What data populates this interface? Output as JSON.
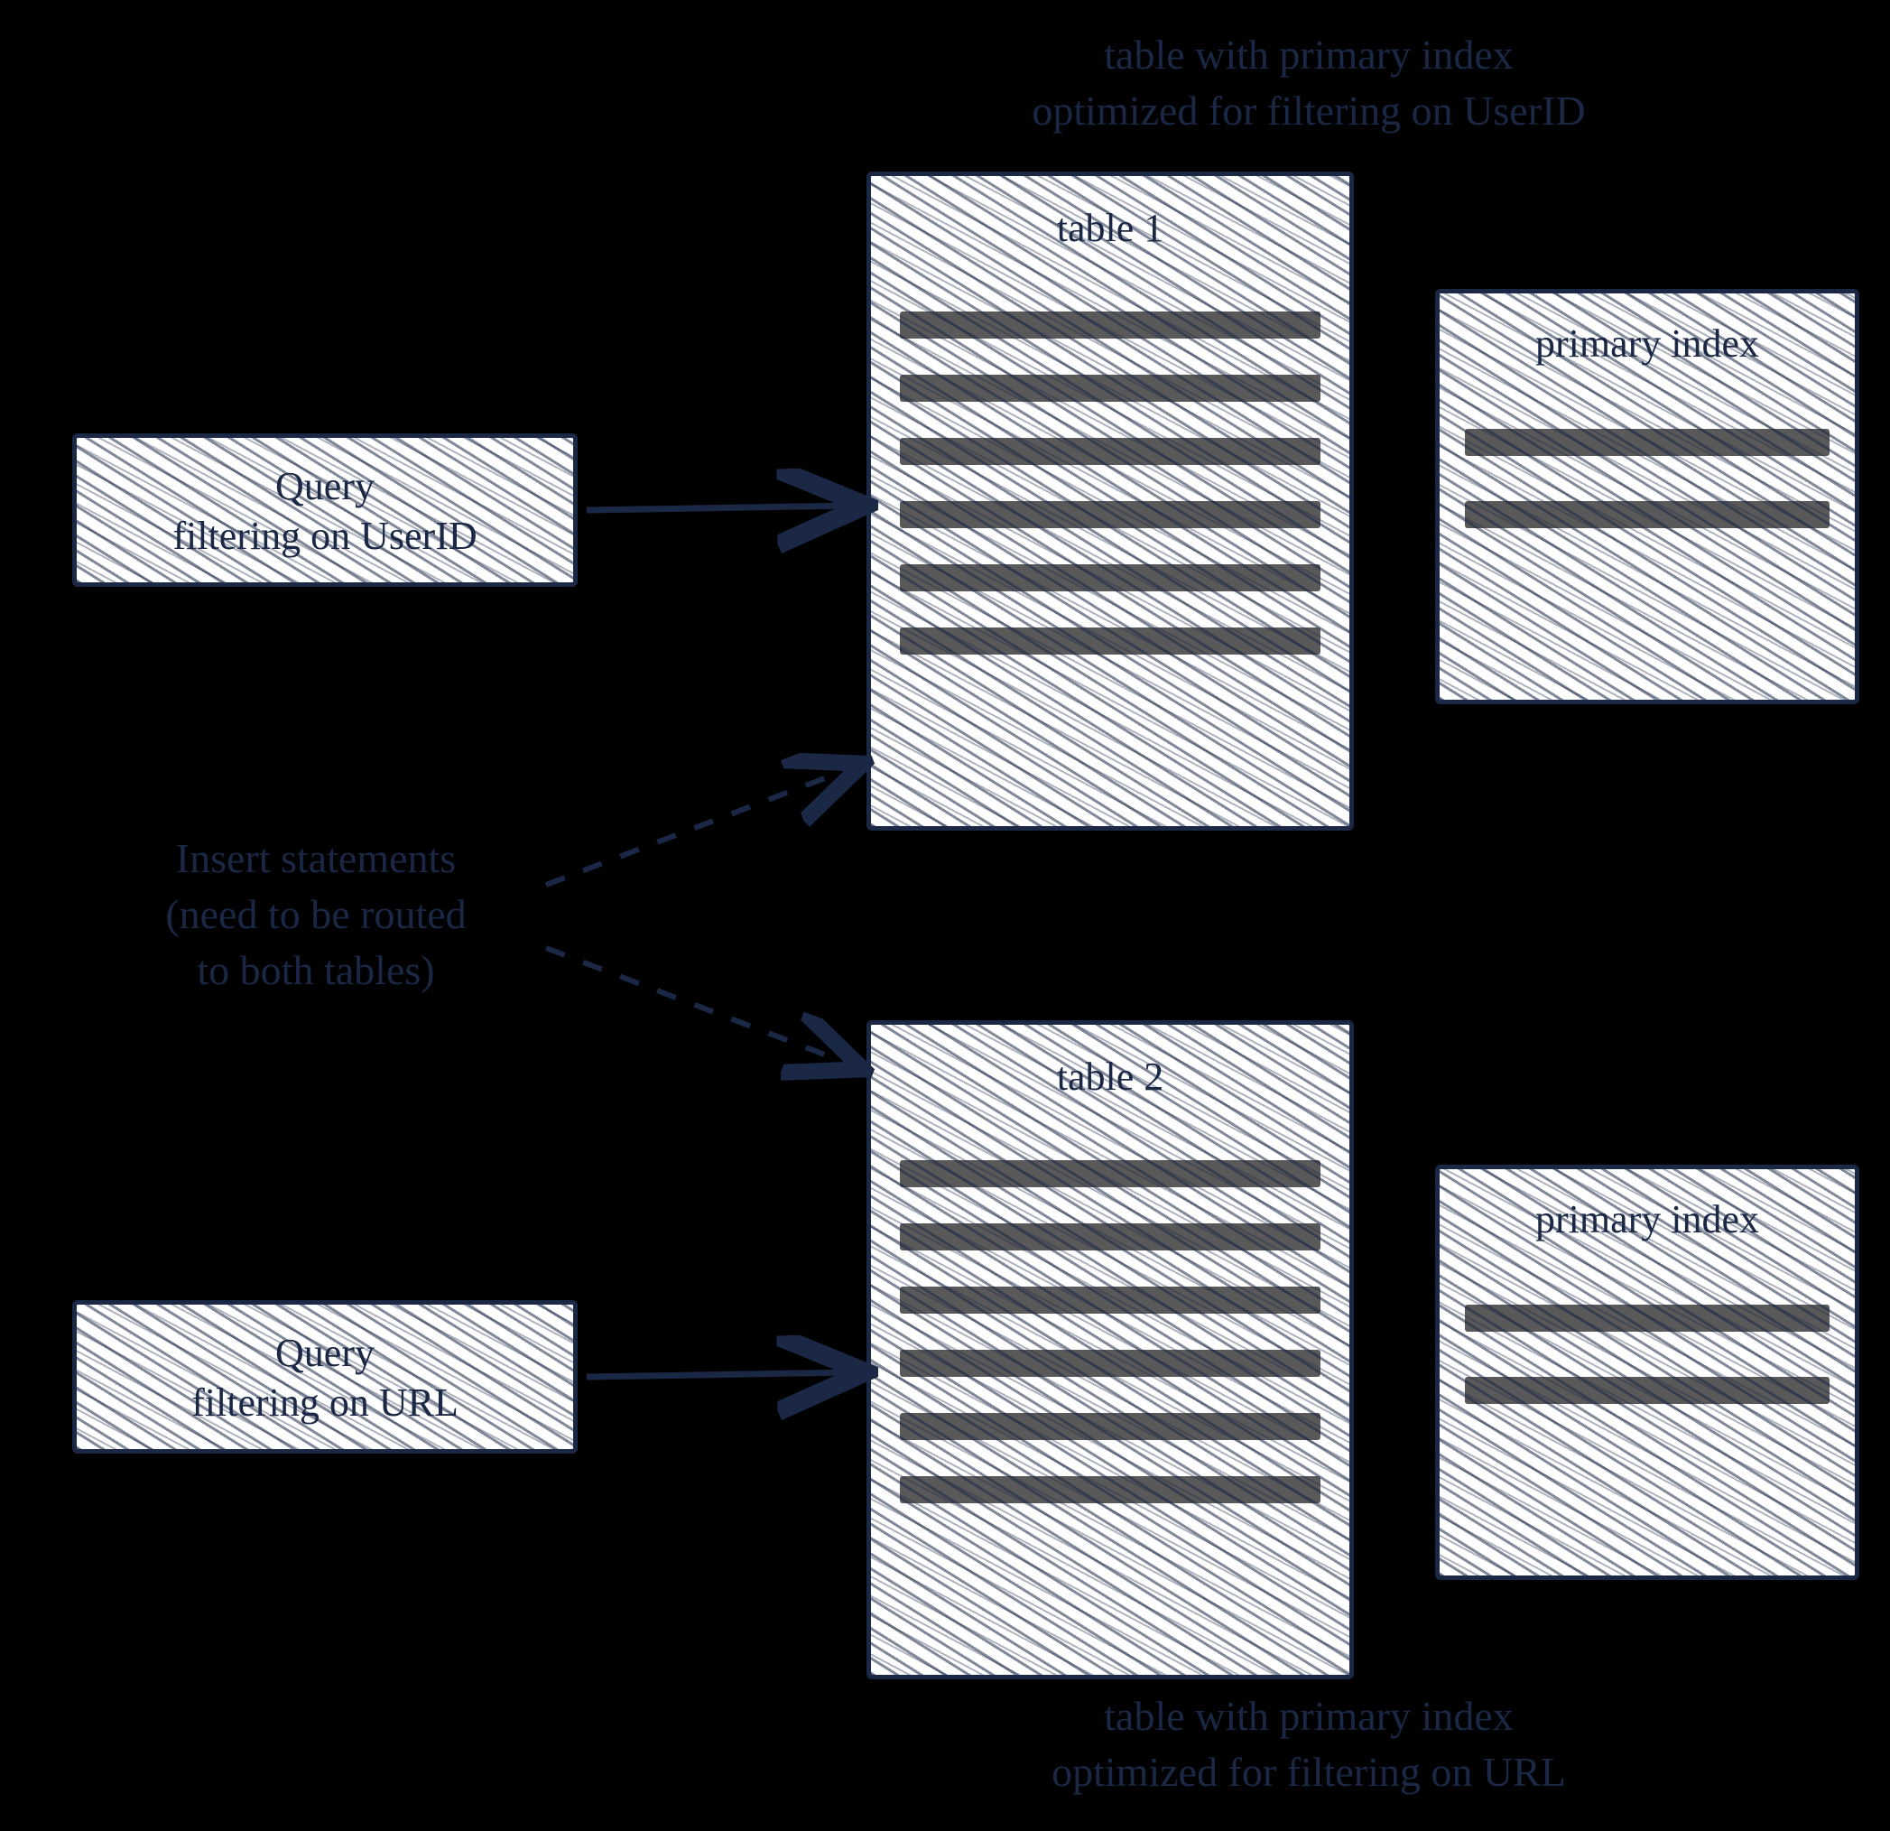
{
  "captions": {
    "top": "table with primary index\noptimized for filtering on UserID",
    "bottom": "table with primary index\noptimized for filtering on URL",
    "insert": "Insert statements\n(need to be routed\nto both tables)"
  },
  "queryBoxes": {
    "userId": {
      "line1": "Query",
      "line2": "filtering on UserID"
    },
    "url": {
      "line1": "Query",
      "line2": "filtering on URL"
    }
  },
  "tables": {
    "t1": "table 1",
    "t2": "table 2",
    "indexLabel": "primary index"
  }
}
